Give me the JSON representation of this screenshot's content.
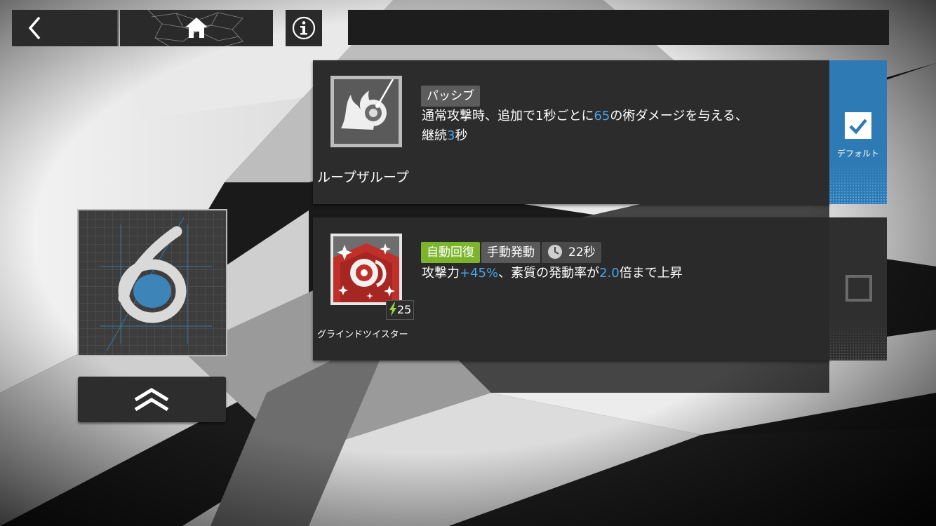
{
  "skills": [
    {
      "tag": "パッシブ",
      "description_parts": [
        "通常攻撃時、追加で1秒ごとに",
        "65",
        "の術ダメージを与える、",
        "継続",
        "3",
        "秒"
      ],
      "name": "ループザループ",
      "icon": "flaming-eye-icon",
      "slot_label": "デフォルト",
      "slot_checked": true
    },
    {
      "tags": [
        "自動回復",
        "手動発動"
      ],
      "cooldown": "22秒",
      "description_parts": [
        "攻撃力",
        "+45%",
        "、素質の発動率が",
        "2.0",
        "倍まで上昇"
      ],
      "cost": "25",
      "name": "グラインドツイスター",
      "icon": "sparkling-eye-icon",
      "slot_checked": false
    }
  ],
  "level_card": {
    "digit": "6"
  },
  "icons": {
    "back": "chevron-left-icon",
    "home": "home-icon",
    "info": "info-icon",
    "level_up": "double-chevron-up-icon",
    "cost": "lightning-icon",
    "cooldown": "clock-icon",
    "check": "checkmark-icon"
  },
  "colors": {
    "accent_blue": "#4aa3e6",
    "slot_blue": "#2d7ab5",
    "auto_tag_green": "#7cb52c",
    "manual_tag_gray": "#5a5a5a",
    "passive_tag_gray": "#5c5c5c",
    "skill2_icon_red": "#c0302b"
  }
}
